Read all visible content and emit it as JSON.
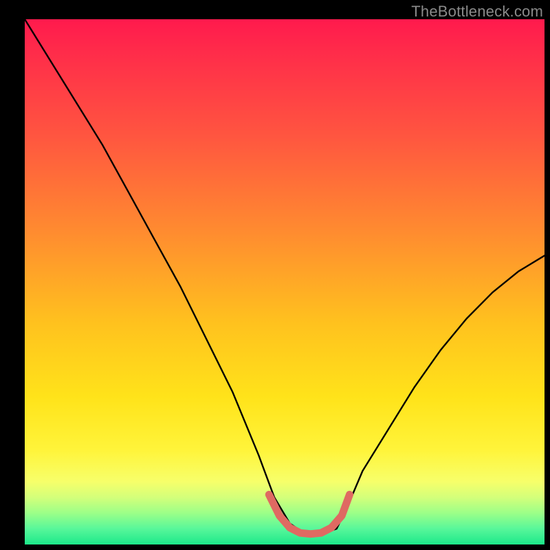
{
  "watermark": "TheBottleneck.com",
  "chart_data": {
    "type": "line",
    "title": "",
    "xlabel": "",
    "ylabel": "",
    "xlim": [
      0,
      100
    ],
    "ylim": [
      0,
      100
    ],
    "grid": false,
    "legend": false,
    "annotations": [],
    "series": [
      {
        "name": "curve",
        "color": "#000000",
        "x": [
          0,
          5,
          10,
          15,
          20,
          25,
          30,
          35,
          40,
          45,
          48,
          51,
          54,
          57,
          60,
          62,
          65,
          70,
          75,
          80,
          85,
          90,
          95,
          100
        ],
        "values": [
          100,
          92,
          84,
          76,
          67,
          58,
          49,
          39,
          29,
          17,
          9,
          4,
          2,
          2,
          3,
          7,
          14,
          22,
          30,
          37,
          43,
          48,
          52,
          55
        ]
      },
      {
        "name": "trough-highlight",
        "color": "#e06a62",
        "x": [
          47,
          49,
          51,
          53,
          55,
          57,
          59,
          61,
          62.5
        ],
        "values": [
          9.5,
          5.5,
          3.2,
          2.2,
          2.0,
          2.2,
          3.2,
          5.5,
          9.5
        ]
      }
    ],
    "background_gradient_stops": [
      {
        "pos": 0,
        "color": "#ff1a4d"
      },
      {
        "pos": 22,
        "color": "#ff5540"
      },
      {
        "pos": 58,
        "color": "#ffc21e"
      },
      {
        "pos": 82,
        "color": "#fff43a"
      },
      {
        "pos": 94,
        "color": "#9cff88"
      },
      {
        "pos": 100,
        "color": "#1ce88a"
      }
    ]
  }
}
